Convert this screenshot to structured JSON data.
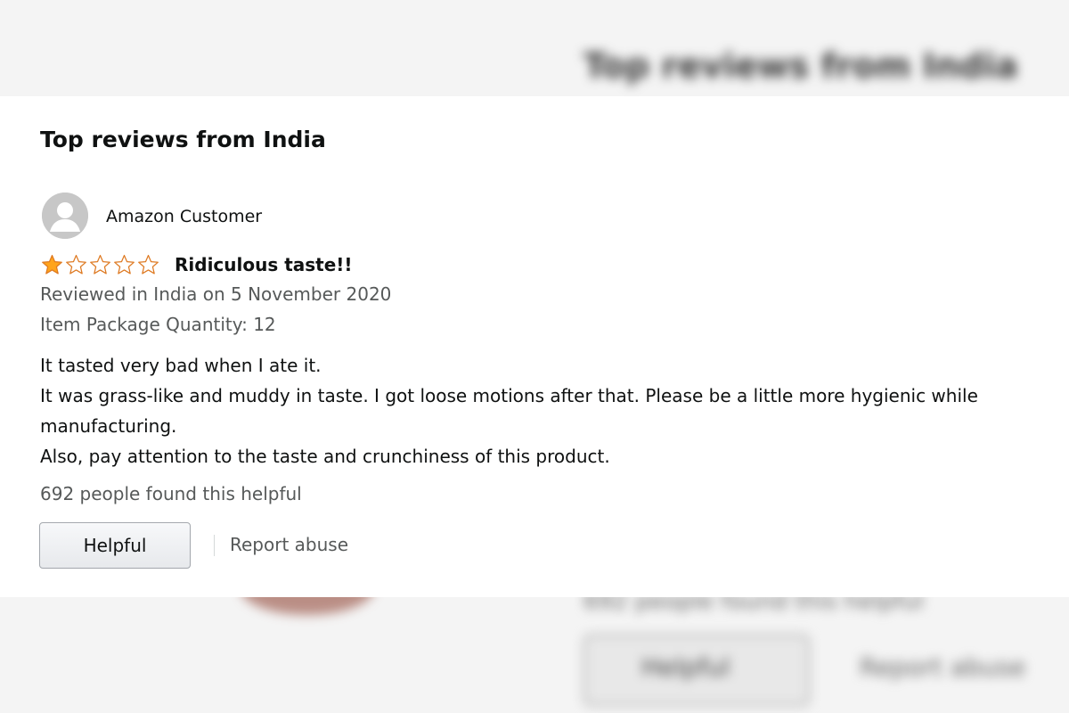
{
  "background": {
    "title": "Top reviews from India",
    "helpful_count": "692 people found this helpful",
    "helpful_button": "Helpful",
    "report_link": "Report abuse"
  },
  "reviews": {
    "section_title": "Top reviews from India",
    "items": [
      {
        "author": "Amazon Customer",
        "avatar_icon": "user-avatar-icon",
        "rating": 1,
        "rating_max": 5,
        "star_color": "#ffa41c",
        "title": "Ridiculous taste!!",
        "reviewed_line": "Reviewed in India on 5 November 2020",
        "variant_line": "Item Package Quantity: 12",
        "body": [
          "It tasted very bad when I ate it.",
          "It was grass-like and muddy in taste. I got loose motions after that. Please be a little more hygienic while manufacturing.",
          "Also, pay attention to the taste and crunchiness of this product."
        ],
        "helpful_count": "692 people found this helpful",
        "helpful_button": "Helpful",
        "report_link": "Report abuse"
      }
    ]
  }
}
